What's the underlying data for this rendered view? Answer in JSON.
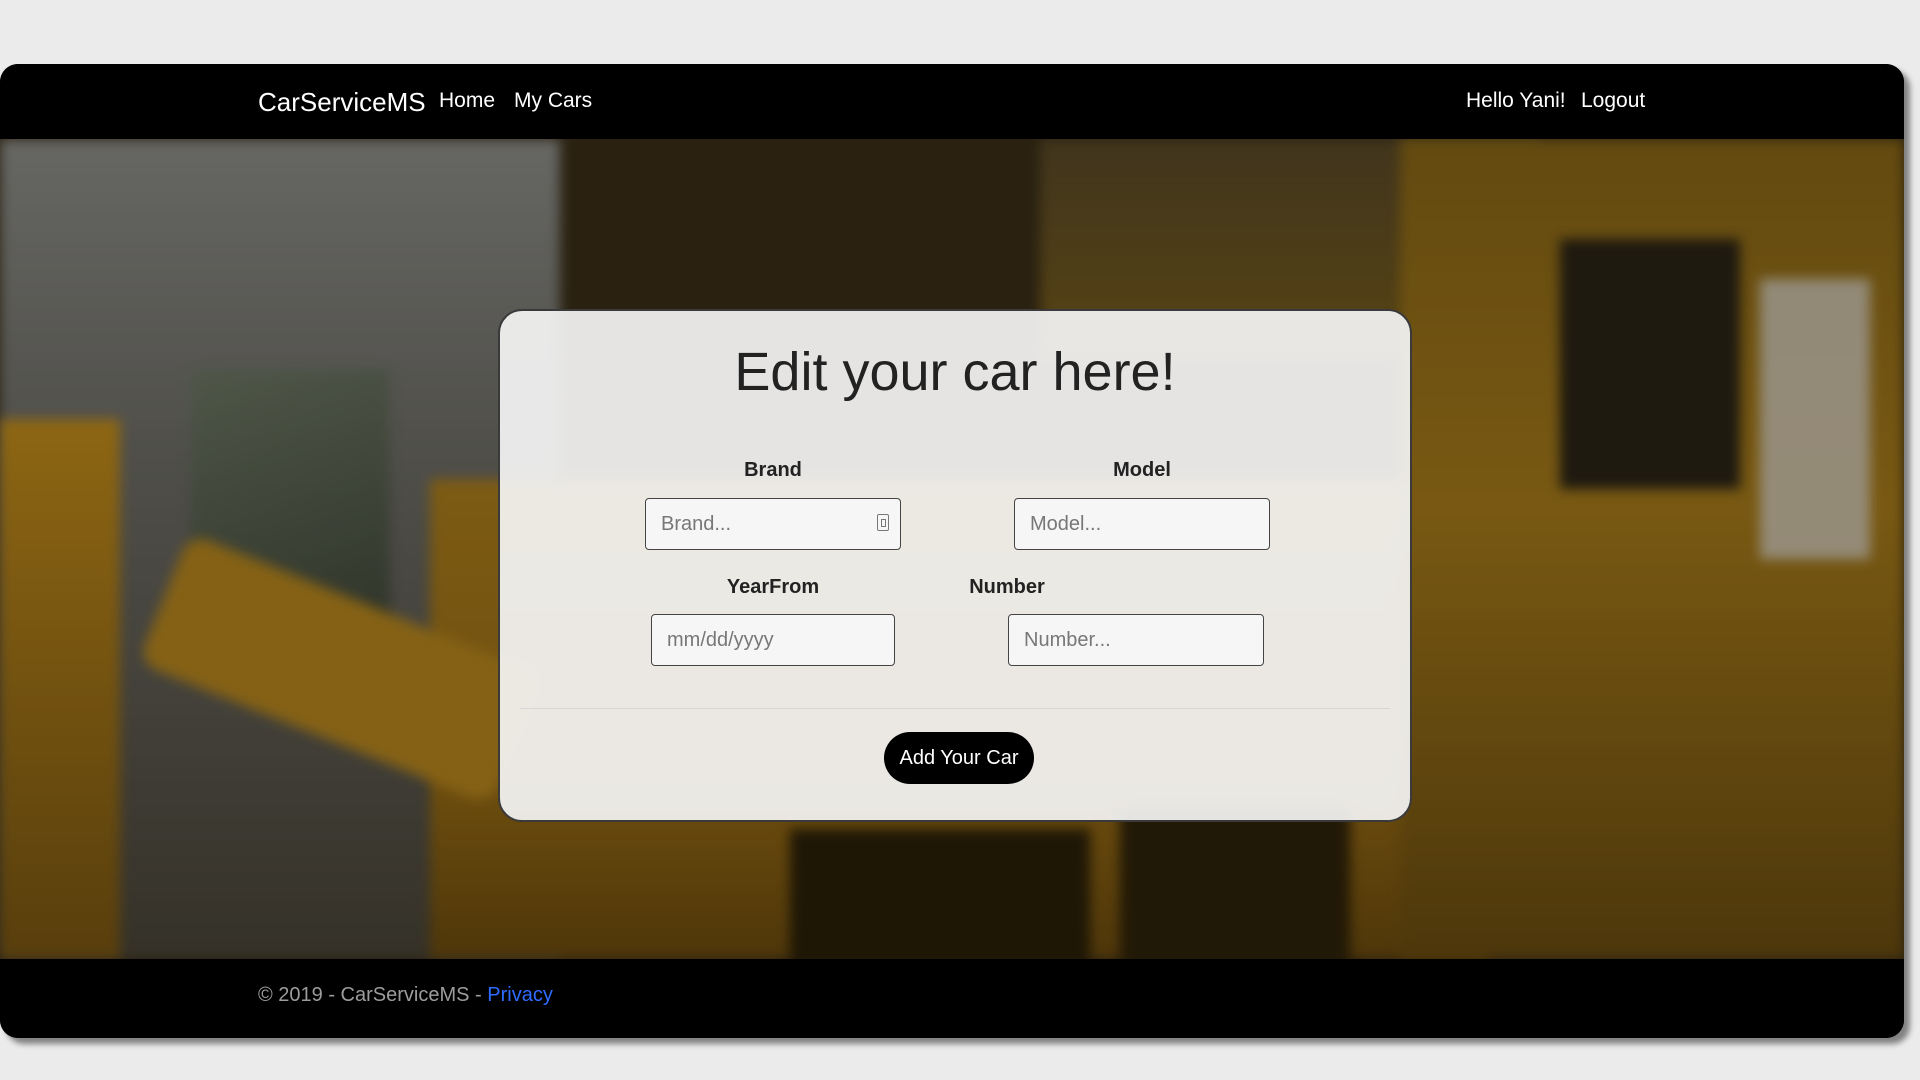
{
  "navbar": {
    "brand": "CarServiceMS",
    "links": [
      {
        "label": "Home"
      },
      {
        "label": "My Cars"
      }
    ],
    "greeting": "Hello Yani!",
    "logout_label": "Logout"
  },
  "form": {
    "title": "Edit your car here!",
    "fields": {
      "brand": {
        "label": "Brand",
        "placeholder": "Brand..."
      },
      "model": {
        "label": "Model",
        "placeholder": "Model..."
      },
      "year_from": {
        "label": "YearFrom",
        "placeholder": "mm/dd/yyyy"
      },
      "number": {
        "label": "Number",
        "placeholder": "Number..."
      }
    },
    "submit_label": "Add Your Car"
  },
  "footer": {
    "copyright": "© 2019 - CarServiceMS - ",
    "privacy_label": "Privacy"
  },
  "colors": {
    "navbar_bg": "#000000",
    "button_bg": "#000000",
    "link": "#2f6bff"
  }
}
